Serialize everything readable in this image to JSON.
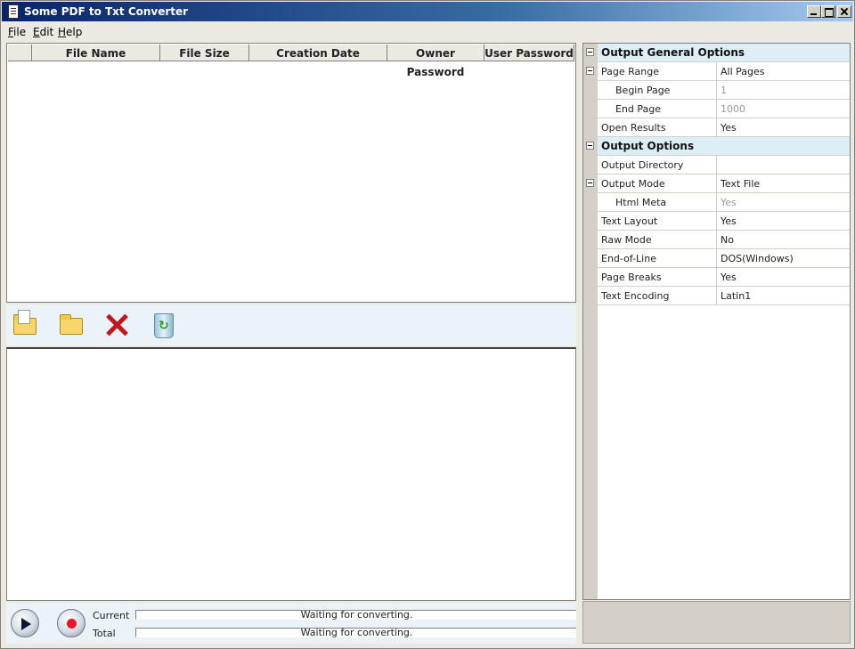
{
  "window": {
    "title": "Some PDF to Txt Converter"
  },
  "menu": [
    {
      "label": "File",
      "key": "F",
      "rest": "ile"
    },
    {
      "label": "Edit",
      "key": "E",
      "rest": "dit"
    },
    {
      "label": "Help",
      "key": "H",
      "rest": "elp"
    }
  ],
  "file_table": {
    "columns": [
      "File Name",
      "File Size",
      "Creation Date",
      "Owner Password",
      "User Password"
    ],
    "rows": []
  },
  "toolbar": {
    "icons": [
      "add-file-icon",
      "add-folder-icon",
      "delete-icon",
      "clear-recycle-icon"
    ]
  },
  "progress": {
    "current_label": "Current",
    "total_label": "Total",
    "current_text": "Waiting for converting.",
    "total_text": "Waiting for converting."
  },
  "properties": {
    "general_group": "Output General Options",
    "page_range": {
      "name": "Page Range",
      "value": "All Pages"
    },
    "begin_page": {
      "name": "Begin Page",
      "value": "1"
    },
    "end_page": {
      "name": "End Page",
      "value": "1000"
    },
    "open_results": {
      "name": "Open Results",
      "value": "Yes"
    },
    "output_group": "Output Options",
    "output_directory": {
      "name": "Output Directory",
      "value": ""
    },
    "output_mode": {
      "name": "Output Mode",
      "value": "Text File"
    },
    "html_meta": {
      "name": "Html Meta",
      "value": "Yes"
    },
    "text_layout": {
      "name": "Text Layout",
      "value": "Yes"
    },
    "raw_mode": {
      "name": "Raw Mode",
      "value": "No"
    },
    "end_of_line": {
      "name": "End-of-Line",
      "value": "DOS(Windows)"
    },
    "page_breaks": {
      "name": "Page Breaks",
      "value": "Yes"
    },
    "text_encoding": {
      "name": "Text Encoding",
      "value": "Latin1"
    }
  }
}
